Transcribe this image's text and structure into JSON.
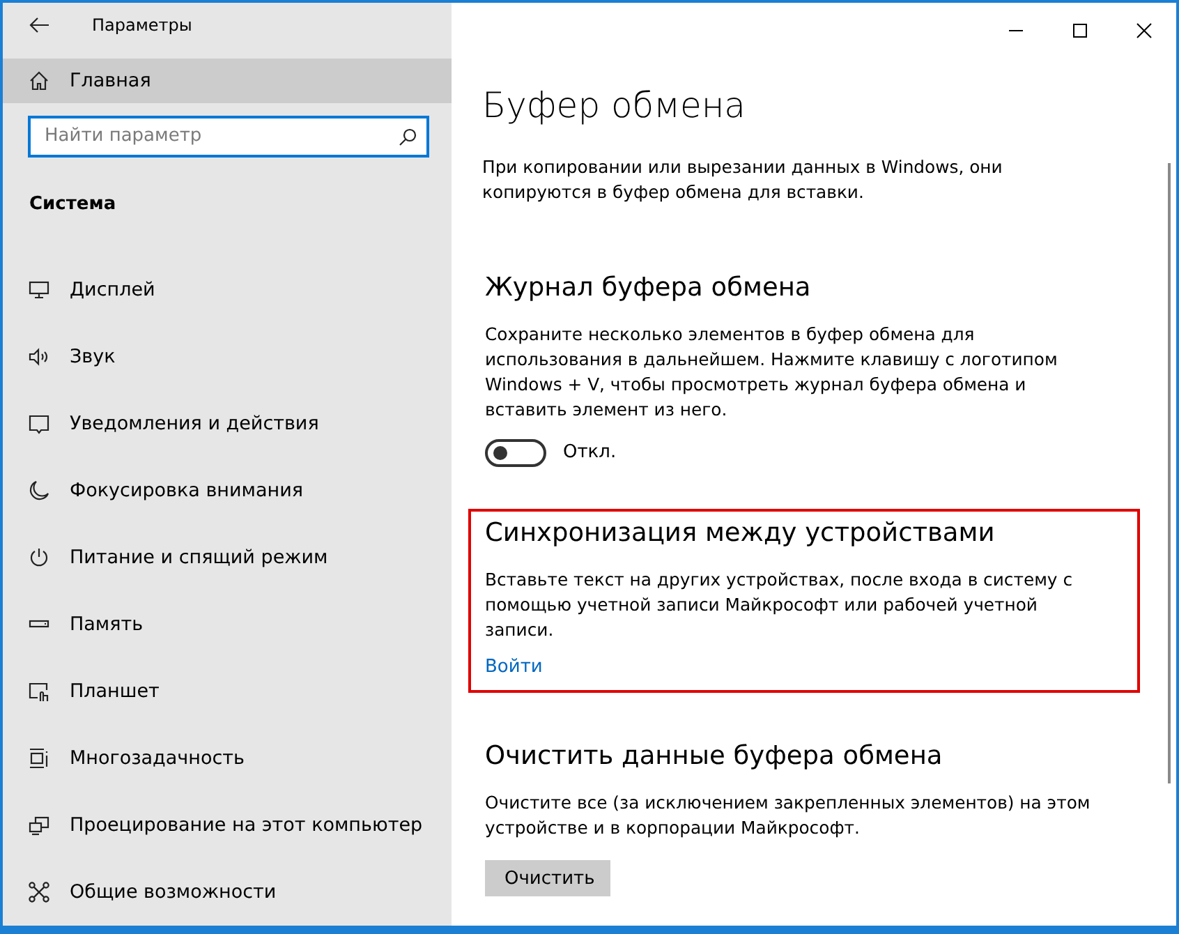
{
  "window": {
    "title": "Параметры"
  },
  "sidebar": {
    "home": {
      "label": "Главная",
      "selected": true
    },
    "search": {
      "placeholder": "Найти параметр"
    },
    "group": "Система",
    "items": [
      {
        "label": "Дисплей",
        "selected": false
      },
      {
        "label": "Звук",
        "selected": false
      },
      {
        "label": "Уведомления и действия",
        "selected": false
      },
      {
        "label": "Фокусировка внимания",
        "selected": false
      },
      {
        "label": "Питание и спящий режим",
        "selected": false
      },
      {
        "label": "Память",
        "selected": false
      },
      {
        "label": "Планшет",
        "selected": false
      },
      {
        "label": "Многозадачность",
        "selected": false
      },
      {
        "label": "Проецирование на этот компьютер",
        "selected": false
      },
      {
        "label": "Общие возможности",
        "selected": false
      }
    ]
  },
  "page": {
    "title": "Буфер обмена",
    "intro": "При копировании или вырезании данных в Windows, они копируются в буфер обмена для вставки.",
    "sections": [
      {
        "kind": "toggle",
        "heading": "Журнал буфера обмена",
        "text": "Сохраните несколько элементов в буфер обмена для использования в дальнейшем. Нажмите клавишу с логотипом Windows + V, чтобы просмотреть журнал буфера обмена и вставить элемент из него.",
        "on": false,
        "state_label": "Откл.",
        "highlighted": false
      },
      {
        "kind": "link",
        "heading": "Синхронизация между устройствами",
        "text": "Вставьте текст на других устройствах, после входа в систему с помощью учетной записи Майкрософт или рабочей учетной записи.",
        "link": "Войти",
        "highlighted": true
      },
      {
        "kind": "button",
        "heading": "Очистить данные буфера обмена",
        "text": "Очистите все (за исключением закрепленных элементов) на этом устройстве и в корпорации Майкрософт.",
        "button": "Очистить",
        "highlighted": false
      }
    ]
  }
}
